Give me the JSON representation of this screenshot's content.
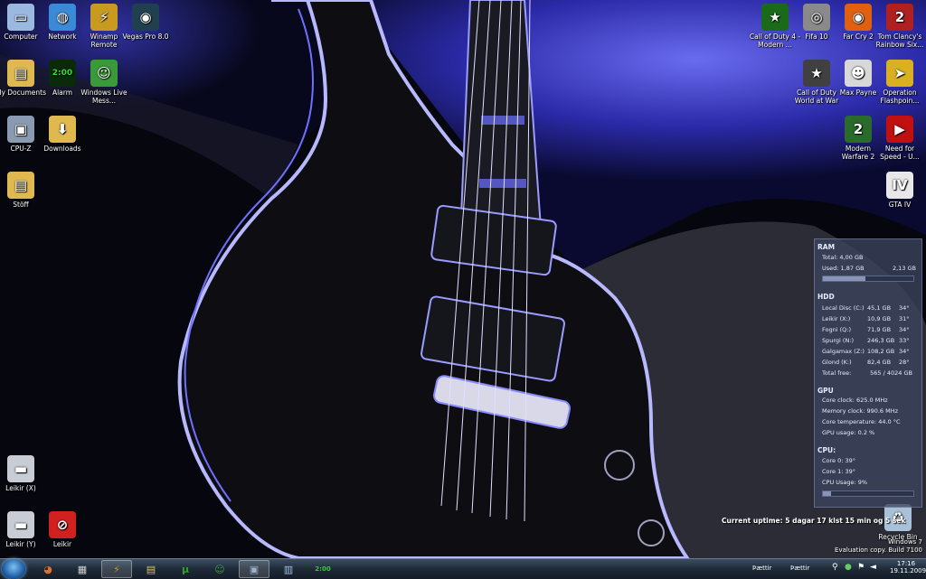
{
  "desktop_icons": [
    {
      "label": "Computer",
      "icon": "computer-icon",
      "color": "#9ab8e0",
      "glyph": "▭"
    },
    {
      "label": "Network",
      "icon": "network-globe-icon",
      "color": "#3a8ad8",
      "glyph": "◍"
    },
    {
      "label": "Winamp Remote",
      "icon": "winamp-icon",
      "color": "#c89a20",
      "glyph": "⚡"
    },
    {
      "label": "Vegas Pro 8.0",
      "icon": "vegas-icon",
      "color": "#204050",
      "glyph": "◉"
    },
    {
      "label": "My Documents",
      "icon": "folder-icon",
      "color": "#e0b850",
      "glyph": "▤"
    },
    {
      "label": "Alarm",
      "icon": "alarm-clock-icon",
      "color": "#0a2a0a",
      "glyph": "2:00"
    },
    {
      "label": "Windows Live Mess...",
      "icon": "messenger-icon",
      "color": "#3a9a3a",
      "glyph": "☺"
    },
    {
      "label": "CPU-Z",
      "icon": "cpuz-icon",
      "color": "#8a9ab0",
      "glyph": "▣"
    },
    {
      "label": "Downloads",
      "icon": "downloads-folder-icon",
      "color": "#e0b850",
      "glyph": "⬇"
    },
    {
      "label": "Stöff",
      "icon": "folder-icon",
      "color": "#e0b850",
      "glyph": "▤"
    },
    {
      "label": "Leikir (X)",
      "icon": "drive-icon",
      "color": "#c8ccd4",
      "glyph": "▬"
    },
    {
      "label": "Leikir (Y)",
      "icon": "drive-icon",
      "color": "#c8ccd4",
      "glyph": "▬"
    },
    {
      "label": "Leikir",
      "icon": "blocked-icon",
      "color": "#d02020",
      "glyph": "⊘"
    },
    {
      "label": "Call of Duty 4 - Modern ...",
      "icon": "cod4-icon",
      "color": "#1a6a1a",
      "glyph": "★"
    },
    {
      "label": "Fifa 10",
      "icon": "fifa-icon",
      "color": "#8a8a8a",
      "glyph": "◎"
    },
    {
      "label": "Far Cry 2",
      "icon": "farcry-icon",
      "color": "#e06010",
      "glyph": "◉"
    },
    {
      "label": "Tom Clancy's Rainbow Six...",
      "icon": "vegas2-icon",
      "color": "#b02020",
      "glyph": "2"
    },
    {
      "label": "Call of Duty World at War",
      "icon": "cod-waw-icon",
      "color": "#404040",
      "glyph": "★"
    },
    {
      "label": "Max Payne",
      "icon": "maxpayne-icon",
      "color": "#d8d8d8",
      "glyph": "☻"
    },
    {
      "label": "Operation Flashpoin...",
      "icon": "flashpoint-icon",
      "color": "#d8b020",
      "glyph": "➤"
    },
    {
      "label": "Modern Warfare 2",
      "icon": "mw2-icon",
      "color": "#2a6a2a",
      "glyph": "2"
    },
    {
      "label": "Need for Speed - U...",
      "icon": "nfs-icon",
      "color": "#c01010",
      "glyph": "▶"
    },
    {
      "label": "GTA IV",
      "icon": "gta4-icon",
      "color": "#e8e8e8",
      "glyph": "IV"
    },
    {
      "label": "Recycle Bin",
      "icon": "recycle-bin-icon",
      "color": "#a8c0d8",
      "glyph": "♻"
    }
  ],
  "gadget": {
    "ram_title": "RAM",
    "ram_total": "Total: 4,00 GB",
    "ram_used": "Used: 1,87 GB",
    "ram_free": "2,13 GB",
    "ram_used_fraction": 0.47,
    "hdd_title": "HDD",
    "hdd_rows": [
      {
        "name": "Local Disc (C:)",
        "free": "45,1 GB",
        "temp": "34°"
      },
      {
        "name": "Leikir (X:)",
        "free": "10,9 GB",
        "temp": "31°"
      },
      {
        "name": "Fogni (Q:)",
        "free": "71,9 GB",
        "temp": "34°"
      },
      {
        "name": "Spurgi (N:)",
        "free": "246,3 GB",
        "temp": "33°"
      },
      {
        "name": "Galgamax (Z:)",
        "free": "108,2 GB",
        "temp": "34°"
      },
      {
        "name": "Glond (K:)",
        "free": "82,4 GB",
        "temp": "28°"
      }
    ],
    "hdd_total_label": "Total free:",
    "hdd_total": "565 / 4024 GB",
    "gpu_title": "GPU",
    "gpu_rows": [
      "Core clock: 625.0 MHz",
      "Memory clock: 990.6 MHz",
      "Core temperature: 44.0 °C",
      "GPU usage: 0.2 %"
    ],
    "cpu_title": "CPU:",
    "cpu_rows": [
      "Core 0: 39°",
      "Core 1: 39°",
      "CPU Usage: 9%"
    ],
    "cpu_usage_fraction": 0.09
  },
  "uptime": "Current uptime: 5 dagar 17 klst 15 min og 5 sek",
  "watermark": {
    "line1": "Windows 7",
    "line2": "Evaluation copy. Build 7100"
  },
  "taskbar": {
    "items": [
      {
        "icon": "firefox-icon",
        "color": "#e0702a",
        "glyph": "◕",
        "active": false
      },
      {
        "icon": "clapper-icon",
        "color": "#d0d0d0",
        "glyph": "▦",
        "active": false
      },
      {
        "icon": "winamp-icon",
        "color": "#c89a20",
        "glyph": "⚡",
        "active": true
      },
      {
        "icon": "explorer-folder-icon",
        "color": "#e0c060",
        "glyph": "▤",
        "active": false
      },
      {
        "icon": "utorrent-icon",
        "color": "#30a030",
        "glyph": "µ",
        "active": false
      },
      {
        "icon": "messenger-icon",
        "color": "#3a9a3a",
        "glyph": "☺",
        "active": false
      },
      {
        "icon": "cpuz-icon",
        "color": "#a0b0c8",
        "glyph": "▣",
        "active": true
      },
      {
        "icon": "calculator-icon",
        "color": "#a8c0e0",
        "glyph": "▥",
        "active": false
      },
      {
        "icon": "alarm-clock-icon",
        "color": "#30d030",
        "glyph": "2:00",
        "active": false
      }
    ],
    "tray_lang1": "Þættir",
    "tray_lang2": "Þættir",
    "time": "17:16",
    "date": "19.11.2009"
  }
}
